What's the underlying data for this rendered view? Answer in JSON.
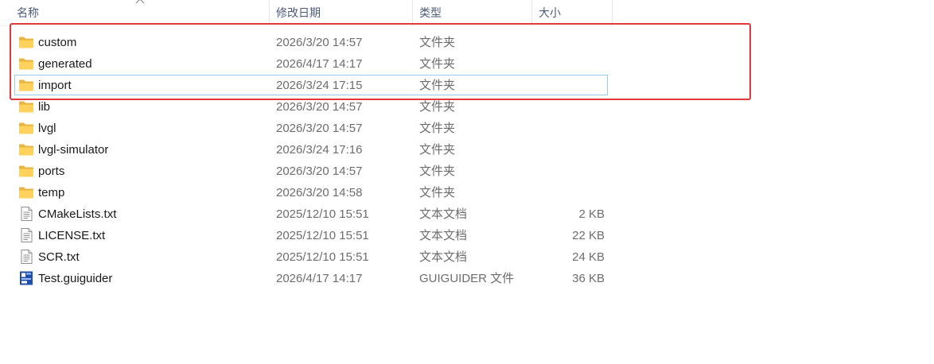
{
  "columns": {
    "name": "名称",
    "date": "修改日期",
    "type": "类型",
    "size": "大小"
  },
  "highlight_color": "#e0383d",
  "focus_color": "#99c9ef",
  "files": [
    {
      "name": "custom",
      "date": "2026/3/20 14:57",
      "type": "文件夹",
      "size": "",
      "icon": "folder-icon"
    },
    {
      "name": "generated",
      "date": "2026/4/17 14:17",
      "type": "文件夹",
      "size": "",
      "icon": "folder-icon"
    },
    {
      "name": "import",
      "date": "2026/3/24 17:15",
      "type": "文件夹",
      "size": "",
      "icon": "folder-icon"
    },
    {
      "name": "lib",
      "date": "2026/3/20 14:57",
      "type": "文件夹",
      "size": "",
      "icon": "folder-icon"
    },
    {
      "name": "lvgl",
      "date": "2026/3/20 14:57",
      "type": "文件夹",
      "size": "",
      "icon": "folder-icon"
    },
    {
      "name": "lvgl-simulator",
      "date": "2026/3/24 17:16",
      "type": "文件夹",
      "size": "",
      "icon": "folder-icon"
    },
    {
      "name": "ports",
      "date": "2026/3/20 14:57",
      "type": "文件夹",
      "size": "",
      "icon": "folder-icon"
    },
    {
      "name": "temp",
      "date": "2026/3/20 14:58",
      "type": "文件夹",
      "size": "",
      "icon": "folder-icon"
    },
    {
      "name": "CMakeLists.txt",
      "date": "2025/12/10 15:51",
      "type": "文本文档",
      "size": "2 KB",
      "icon": "text-file-icon"
    },
    {
      "name": "LICENSE.txt",
      "date": "2025/12/10 15:51",
      "type": "文本文档",
      "size": "22 KB",
      "icon": "text-file-icon"
    },
    {
      "name": "SCR.txt",
      "date": "2025/12/10 15:51",
      "type": "文本文档",
      "size": "24 KB",
      "icon": "text-file-icon"
    },
    {
      "name": "Test.guiguider",
      "date": "2026/4/17 14:17",
      "type": "GUIGUIDER 文件",
      "size": "36 KB",
      "icon": "guiguider-file-icon"
    }
  ]
}
